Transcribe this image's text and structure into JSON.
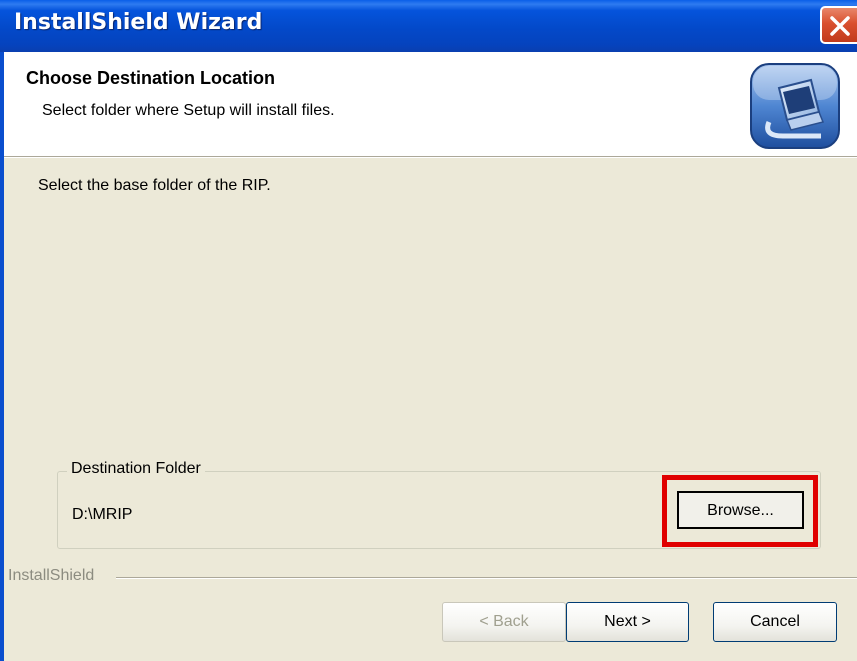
{
  "window": {
    "title": "InstallShield Wizard",
    "close_icon": "close-icon"
  },
  "header": {
    "title": "Choose Destination Location",
    "subtitle": "Select folder where Setup will install files.",
    "icon": "computer-setup-icon"
  },
  "body": {
    "instruction": "Select the base folder of the RIP."
  },
  "destination": {
    "legend": "Destination Folder",
    "path": "D:\\MRIP",
    "browse_label": "Browse..."
  },
  "footer": {
    "brand": "InstallShield",
    "back_label": "< Back",
    "next_label": "Next >",
    "cancel_label": "Cancel"
  },
  "colors": {
    "titlebar": "#0554DC",
    "face": "#ECE9D8",
    "highlight": "#E00000"
  }
}
